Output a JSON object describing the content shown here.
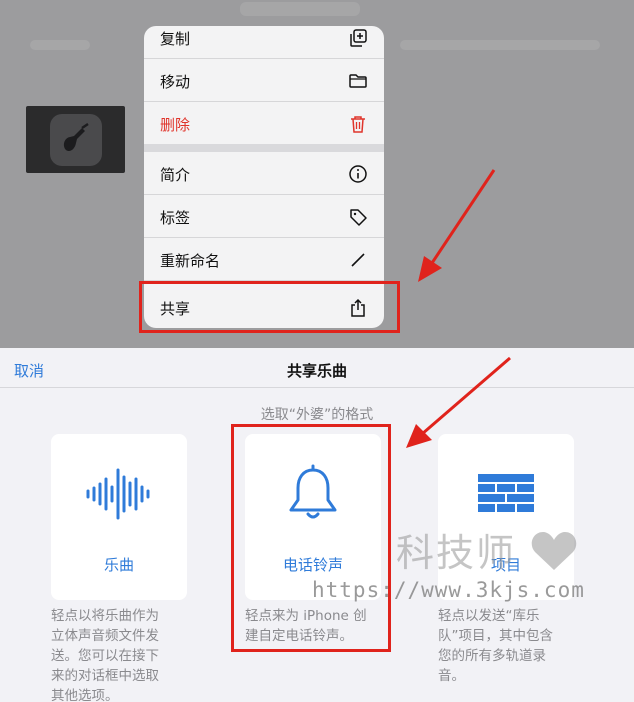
{
  "context_menu": {
    "items": [
      {
        "label": "复制",
        "icon": "duplicate-icon"
      },
      {
        "label": "移动",
        "icon": "folder-icon"
      },
      {
        "label": "删除",
        "icon": "trash-icon"
      },
      {
        "label": "简介",
        "icon": "info-icon"
      },
      {
        "label": "标签",
        "icon": "tag-icon"
      },
      {
        "label": "重新命名",
        "icon": "pencil-icon"
      },
      {
        "label": "共享",
        "icon": "share-icon"
      }
    ]
  },
  "share_sheet": {
    "cancel_label": "取消",
    "title": "共享乐曲",
    "subtitle": "选取“外婆”的格式",
    "options": [
      {
        "label": "乐曲",
        "icon": "waveform-icon",
        "description_lines": [
          "轻点以将乐曲作为",
          "立体声音频文件发",
          "送。您可以在接下",
          "来的对话框中选取",
          "其他选项。"
        ]
      },
      {
        "label": "电话铃声",
        "icon": "bell-icon",
        "description_lines": [
          "轻点来为 iPhone 创",
          "建自定电话铃声。"
        ]
      },
      {
        "label": "项目",
        "icon": "bricks-icon",
        "description_lines": [
          "轻点以发送“库乐",
          "队”项目，其中包含",
          "您的所有多轨道录",
          "音。"
        ]
      }
    ]
  },
  "watermark": {
    "brand": "科技师",
    "url": "https://www.3kjs.com"
  },
  "colors": {
    "accent": "#2f7bd9",
    "danger": "#e0342b",
    "annotation_red": "#e0231c"
  }
}
